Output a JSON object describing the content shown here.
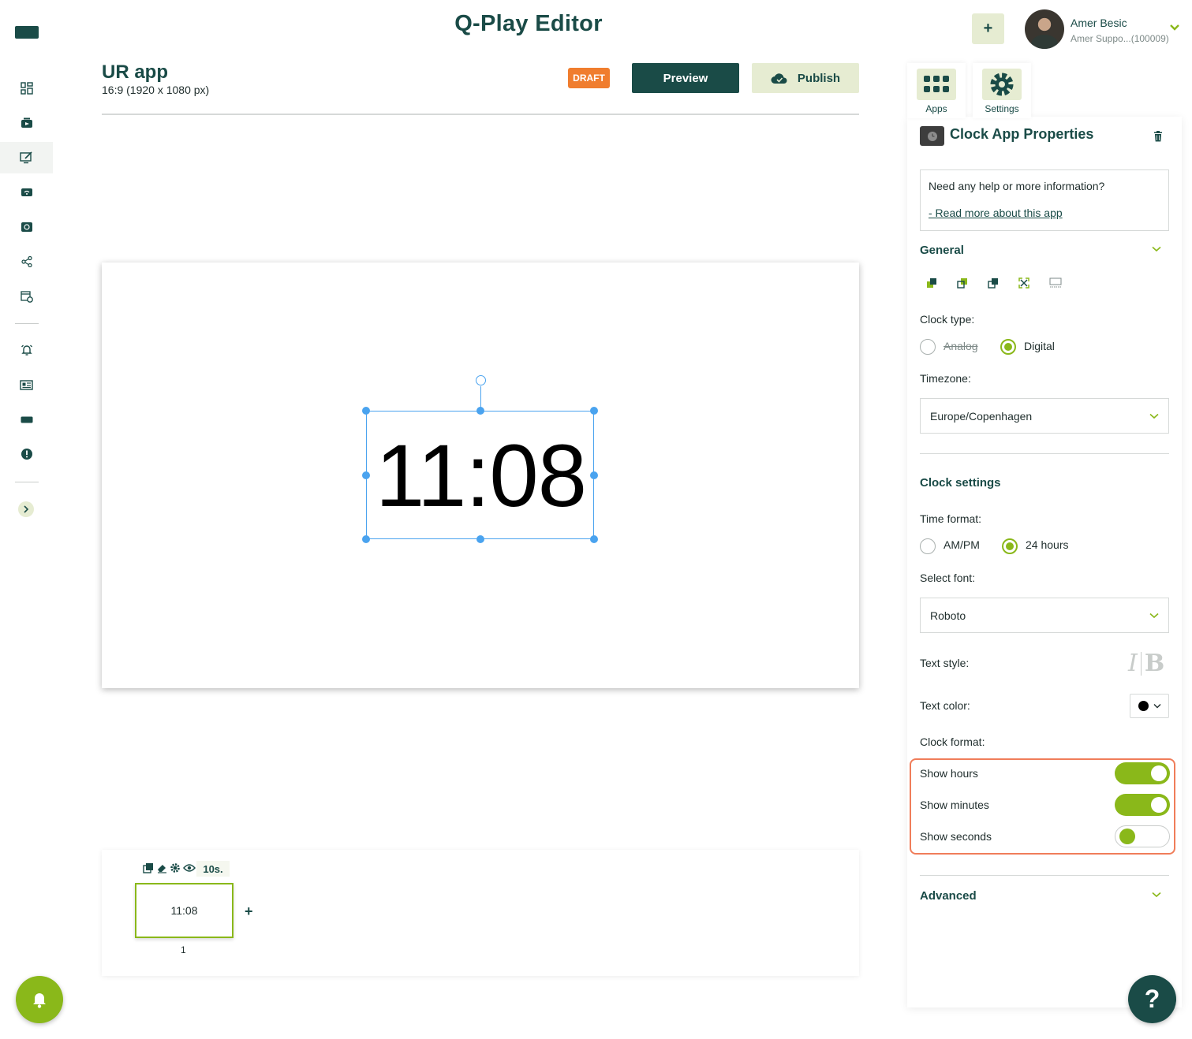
{
  "app": {
    "title": "Q-Play Editor",
    "add_label": "+"
  },
  "user": {
    "name": "Amer Besic",
    "subtitle": "Amer Suppo...(100009)"
  },
  "project": {
    "name": "UR app",
    "size": "16:9 (1920 x 1080 px)",
    "status": "DRAFT",
    "preview_label": "Preview",
    "publish_label": "Publish"
  },
  "canvas": {
    "clock_text": "11:08"
  },
  "timeline": {
    "duration": "10s.",
    "slide_text": "11:08",
    "slide_number": "1",
    "add_label": "+"
  },
  "panel": {
    "tabs": [
      {
        "label": "Apps",
        "icon": "apps-grid-icon"
      },
      {
        "label": "Settings",
        "icon": "gear-icon"
      }
    ],
    "title": "Clock App Properties",
    "help_question": "Need any help or more information?",
    "help_link": "- Read more about this app",
    "general": {
      "title": "General",
      "clock_type_label": "Clock type:",
      "clock_type_options": [
        "Analog",
        "Digital"
      ],
      "clock_type_selected": "Digital",
      "timezone_label": "Timezone:",
      "timezone_value": "Europe/Copenhagen"
    },
    "clock_settings": {
      "title": "Clock settings",
      "time_format_label": "Time format:",
      "time_format_options": [
        "AM/PM",
        "24 hours"
      ],
      "time_format_selected": "24 hours",
      "font_label": "Select font:",
      "font_value": "Roboto",
      "text_style_label": "Text style:",
      "italic_glyph": "I",
      "bold_glyph": "B",
      "text_color_label": "Text color:",
      "text_color": "#000000",
      "clock_format_label": "Clock format:",
      "toggles": [
        {
          "label": "Show hours",
          "on": true
        },
        {
          "label": "Show minutes",
          "on": true
        },
        {
          "label": "Show seconds",
          "on": false
        }
      ]
    },
    "advanced": {
      "title": "Advanced"
    }
  },
  "help_fab": "?",
  "colors": {
    "brand_dark": "#1a4b47",
    "brand_green": "#8ab81a",
    "accent_orange": "#f07d2e",
    "light_green": "#e6ecd2"
  }
}
